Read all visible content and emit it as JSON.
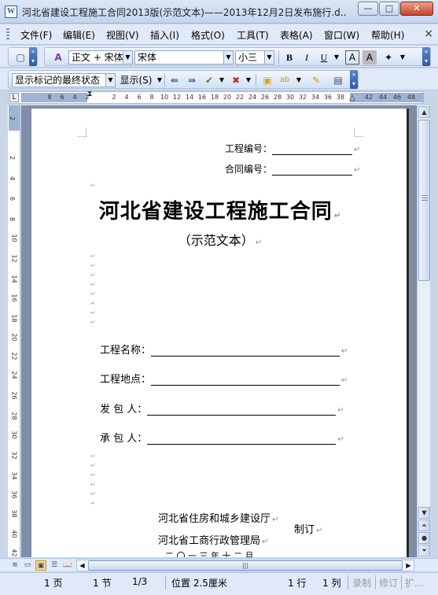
{
  "window": {
    "title": "河北省建设工程施工合同2013版(示范文本)——2013年12月2日发布施行.d...",
    "app_icon": "W",
    "minimize": "—",
    "maximize": "□",
    "close": "✕"
  },
  "menu": {
    "items": [
      "文件(F)",
      "编辑(E)",
      "视图(V)",
      "插入(I)",
      "格式(O)",
      "工具(T)",
      "表格(A)",
      "窗口(W)",
      "帮助(H)"
    ],
    "close_doc": "×"
  },
  "formatting": {
    "style": "正文 + 宋体",
    "font": "宋体",
    "size": "小三",
    "bold": "B",
    "italic": "I",
    "underline": "U",
    "char_border": "A",
    "char_shading": "A"
  },
  "review": {
    "display_mode": "显示标记的最终状态",
    "show_menu": "显示(S)"
  },
  "ruler": {
    "ticks": [
      "8",
      "6",
      "4",
      "2",
      "2",
      "4",
      "6",
      "8",
      "10",
      "12",
      "14",
      "16",
      "18",
      "20",
      "22",
      "24",
      "26",
      "28",
      "30",
      "32",
      "34",
      "36",
      "38",
      "42",
      "44",
      "46",
      "48"
    ],
    "corner": "L",
    "vertical_ticks": [
      "2",
      "2",
      "4",
      "6",
      "8",
      "10",
      "12",
      "14",
      "16",
      "18",
      "20",
      "22",
      "24",
      "26",
      "28",
      "30",
      "32",
      "34",
      "36",
      "38",
      "40",
      "42"
    ]
  },
  "document": {
    "project_no_label": "工程编号：",
    "contract_no_label": "合同编号：",
    "title": "河北省建设工程施工合同",
    "subtitle": "（示范文本）",
    "project_name_label": "工程名称：",
    "project_site_label": "工程地点：",
    "employer_label": "发 包 人：",
    "contractor_label": "承 包 人：",
    "issuer1": "河北省住房和城乡建设厅",
    "issuer2": "河北省工商行政管理局",
    "issued_word": "制订",
    "date": "二 〇 一 三 年 十 二 月",
    "para_mark": "↵"
  },
  "status": {
    "page": "1 页",
    "section": "1 节",
    "page_of": "1/3",
    "position": "位置 2.5厘米",
    "line": "1 行",
    "column": "1 列",
    "record": "录制",
    "revise": "修订",
    "extend": "扩..."
  }
}
